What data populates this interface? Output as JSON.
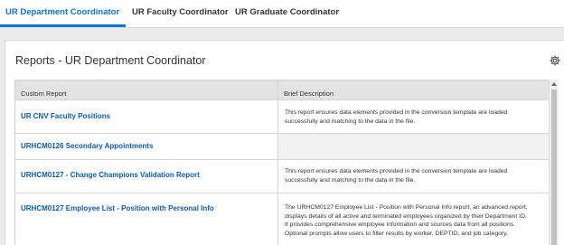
{
  "tabs": [
    {
      "label": "UR Department Coordinator",
      "active": true
    },
    {
      "label": "UR Faculty Coordinator",
      "active": false
    },
    {
      "label": "UR Graduate Coordinator",
      "active": false
    }
  ],
  "panel": {
    "title": "Reports - UR Department Coordinator",
    "settings_icon": "gear-icon"
  },
  "table": {
    "columns": [
      "Custom Report",
      "Brief Description"
    ],
    "rows": [
      {
        "report": "UR CNV Faculty Positions",
        "desc_lines": [
          "This report ensures data elements provided in the conversion template are loaded",
          "successfully and matching to the data in the file."
        ]
      },
      {
        "report": "URHCM0126 Secondary Appointments",
        "desc_lines": []
      },
      {
        "report": "URHCM0127 - Change Champions Validation Report",
        "desc_lines": [
          "This report ensures data elements provided in the conversion template are loaded",
          "successfully and matching to the data in the file."
        ]
      },
      {
        "report": "URHCM0127 Employee List - Position with Personal Info",
        "desc_lines": [
          "The URHCM0127 Employee List - Position with Personal Info report, an advanced report,",
          "displays details of all active and terminated employees organized by their Department ID.",
          "It provides comprehensive employee information and sources data from all positions.",
          "Optional prompts allow users to filter results by worker, DEPTID, and job category."
        ]
      }
    ]
  },
  "colors": {
    "accent": "#0875e1",
    "link": "#0b5cad",
    "header_bg": "#e3e3e3",
    "page_bg": "#ececec"
  }
}
